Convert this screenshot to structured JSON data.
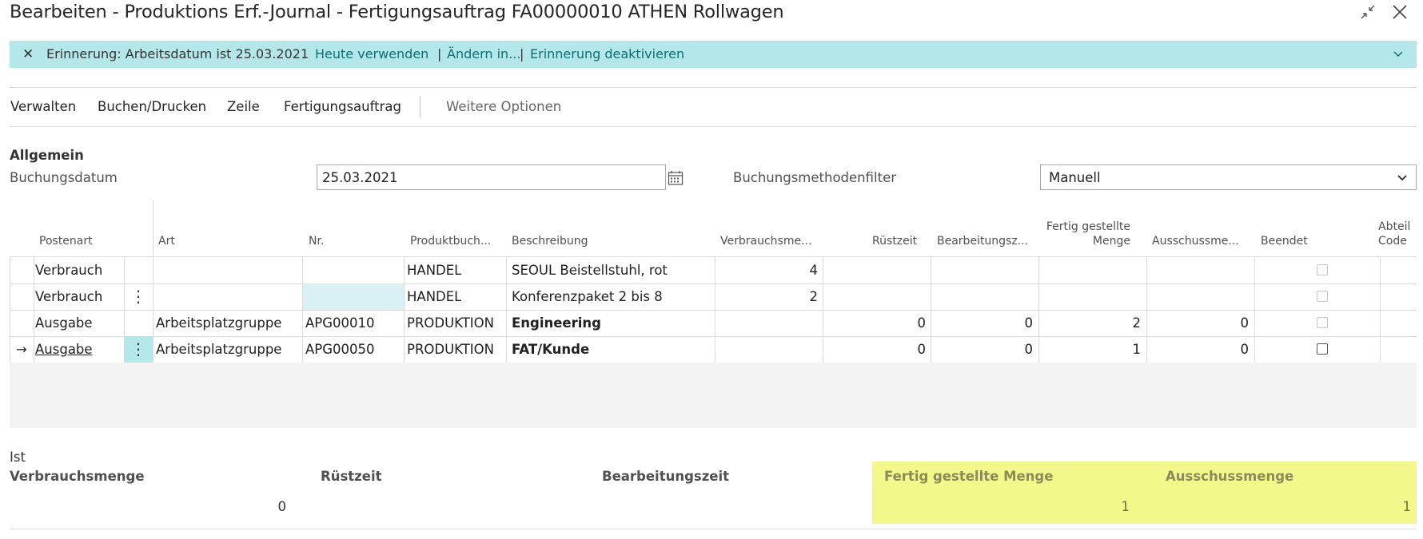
{
  "window": {
    "title": "Bearbeiten - Produktions Erf.-Journal - Fertigungsauftrag FA00000010 ATHEN Rollwagen",
    "collapse_icon": "collapse-icon",
    "close_icon": "close-icon"
  },
  "notification": {
    "message": "Erinnerung: Arbeitsdatum ist 25.03.2021",
    "link_use_today": "Heute verwenden",
    "link_change": "Ändern in...",
    "link_disable": "Erinnerung deaktivieren",
    "separator": "|",
    "background": "#b3e7ea",
    "link_color": "#0e6e74"
  },
  "menu": {
    "items": [
      "Verwalten",
      "Buchen/Drucken",
      "Zeile",
      "Fertigungsauftrag"
    ],
    "more": "Weitere Optionen"
  },
  "general": {
    "heading": "Allgemein",
    "posting_date_label": "Buchungsdatum",
    "posting_date_value": "25.03.2021",
    "posting_method_label": "Buchungsmethodenfilter",
    "posting_method_value": "Manuell"
  },
  "table": {
    "headers": {
      "entry_type": "Postenart",
      "type": "Art",
      "no": "Nr.",
      "gen_prod_posting": "Produktbuch...",
      "description": "Beschreibung",
      "consumption_qty": "Verbrauchsme...",
      "setup_time": "Rüstzeit",
      "run_time": "Bearbeitungsz...",
      "output_qty_line1": "Fertig gestellte",
      "output_qty_line2": "Menge",
      "scrap_qty": "Ausschussme...",
      "finished": "Beendet",
      "dept_line1": "Abteil",
      "dept_line2": "Code"
    },
    "rows": [
      {
        "entry_type": "Verbrauch",
        "type": "",
        "no": "",
        "gen_prod": "HANDEL",
        "description": "SEOUL Beistellstuhl, rot",
        "consumption": "4",
        "setup": "",
        "run": "",
        "output": "",
        "scrap": ""
      },
      {
        "entry_type": "Verbrauch",
        "type": "",
        "no": "",
        "gen_prod": "HANDEL",
        "description": "Konferenzpaket 2 bis 8",
        "consumption": "2",
        "setup": "",
        "run": "",
        "output": "",
        "scrap": ""
      },
      {
        "entry_type": "Ausgabe",
        "type": "Arbeitsplatzgruppe",
        "no": "APG00010",
        "gen_prod": "PRODUKTION",
        "description": "Engineering",
        "consumption": "",
        "setup": "0",
        "run": "0",
        "output": "2",
        "scrap": "0"
      },
      {
        "entry_type": "Ausgabe",
        "type": "Arbeitsplatzgruppe",
        "no": "APG00050",
        "gen_prod": "PRODUKTION",
        "description": "FAT/Kunde",
        "consumption": "",
        "setup": "0",
        "run": "0",
        "output": "1",
        "scrap": "0"
      }
    ],
    "row_arrow_icon": "arrow-right-icon"
  },
  "actual": {
    "heading": "Ist",
    "consumption_label": "Verbrauchsmenge",
    "consumption_value": "0",
    "setup_label": "Rüstzeit",
    "run_label": "Bearbeitungszeit",
    "output_label": "Fertig gestellte Menge",
    "output_value": "1",
    "scrap_label": "Ausschussmenge",
    "scrap_value": "1",
    "highlight_color": "#f2f98a"
  }
}
